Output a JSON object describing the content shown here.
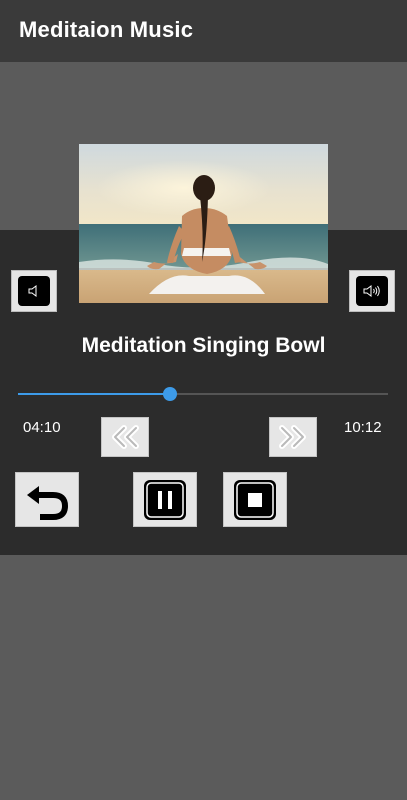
{
  "app_bar": {
    "title": "Meditaion Music"
  },
  "player": {
    "track_title": "Meditation Singing Bowl",
    "elapsed": "04:10",
    "total": "10:12",
    "progress_fraction": 0.41,
    "accent_color": "#3d9be9"
  },
  "icons": {
    "volume_down": "volume-down-icon",
    "volume_up": "volume-up-icon",
    "rewind": "rewind-icon",
    "fast_forward": "fast-forward-icon",
    "back": "back-arrow-icon",
    "pause": "pause-icon",
    "stop": "stop-icon"
  }
}
